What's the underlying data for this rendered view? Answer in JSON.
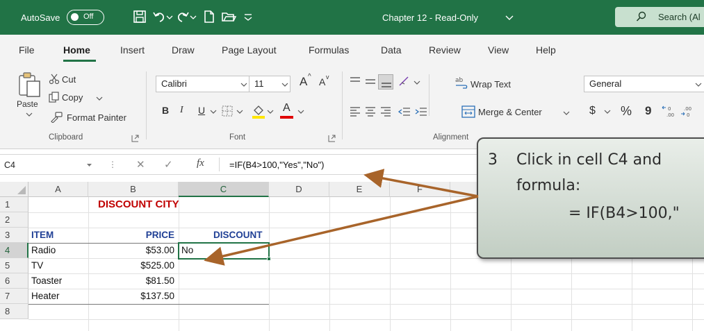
{
  "titlebar": {
    "autosave_label": "AutoSave",
    "autosave_state": "Off",
    "doc_title": "Chapter 12  -  Read-Only",
    "search_label": "Search (Al"
  },
  "tabs": [
    "File",
    "Home",
    "Insert",
    "Draw",
    "Page Layout",
    "Formulas",
    "Data",
    "Review",
    "View",
    "Help"
  ],
  "ribbon": {
    "paste": "Paste",
    "cut": "Cut",
    "copy": "Copy",
    "format_painter": "Format Painter",
    "clipboard": "Clipboard",
    "font_name": "Calibri",
    "font_size": "11",
    "grow_font": "A",
    "shrink_font": "A",
    "bold": "B",
    "italic": "I",
    "underline": "U",
    "font_color_letter": "A",
    "font_group": "Font",
    "wrap_text": "Wrap Text",
    "merge_center": "Merge & Center",
    "alignment_group": "Alignment",
    "number_format": "General",
    "currency": "$",
    "percent": "%",
    "comma": "9"
  },
  "formula_bar": {
    "name_box": "C4",
    "fx": "fx",
    "formula": "=IF(B4>100,\"Yes\",\"No\")"
  },
  "grid": {
    "columns": [
      "A",
      "B",
      "C",
      "D",
      "E",
      "F"
    ],
    "rows": [
      "1",
      "2",
      "3",
      "4",
      "5",
      "6",
      "7",
      "8"
    ],
    "title": "DISCOUNT CITY",
    "header_item": "ITEM",
    "header_price": "PRICE",
    "header_discount": "DISCOUNT",
    "items": [
      {
        "item": "Radio",
        "price": "$53.00",
        "discount": "No"
      },
      {
        "item": "TV",
        "price": "$525.00",
        "discount": ""
      },
      {
        "item": "Toaster",
        "price": "$81.50",
        "discount": ""
      },
      {
        "item": "Heater",
        "price": "$137.50",
        "discount": ""
      }
    ]
  },
  "callout": {
    "number": "3",
    "line1": "Click in cell C4 and",
    "line2": "formula:",
    "line3": "= IF(B4>100,\""
  },
  "colors": {
    "excel_green": "#217346",
    "title_red": "#c00000",
    "header_blue": "#1f3f95",
    "arrow_brown": "#a8642a"
  }
}
